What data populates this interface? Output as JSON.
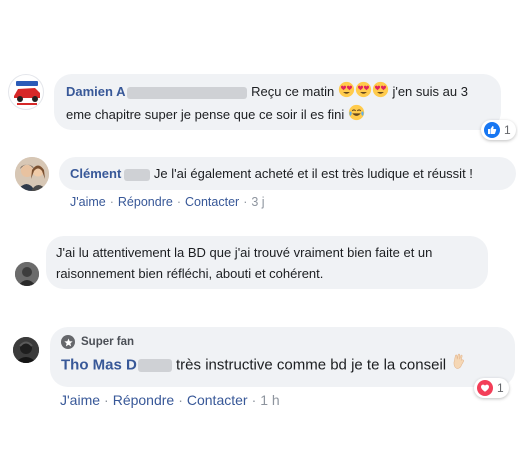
{
  "comments": [
    {
      "author": "Damien A",
      "text_1": "Reçu ce matin",
      "text_2": "j'en suis au 3",
      "text_3": "eme chapitre super je pense que ce soir il es fini",
      "reaction_count": "1",
      "reaction_color": "#1877f2"
    },
    {
      "author": "Clément",
      "text": "Je l'ai également acheté et il est très ludique et réussit !",
      "actions": [
        "J'aime",
        "Répondre",
        "Contacter"
      ],
      "time": "3 j"
    },
    {
      "text_1": "J'ai lu attentivement la BD que j'ai trouvé vraiment bien faite et un",
      "text_2": "raisonnement bien réfléchi, abouti et cohérent."
    },
    {
      "badge": "Super fan",
      "author": "Tho Mas D",
      "text": "très instructive comme bd je te la conseil",
      "actions": [
        "J'aime",
        "Répondre",
        "Contacter"
      ],
      "time": "1 h",
      "reaction_count": "1",
      "reaction_color": "#f33e58"
    }
  ]
}
